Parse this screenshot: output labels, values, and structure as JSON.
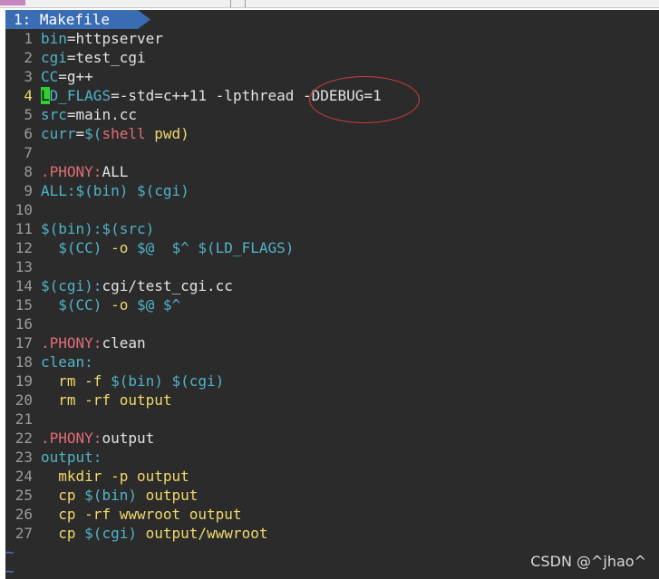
{
  "tab": {
    "label": "1: Makefile"
  },
  "lines": [
    {
      "n": "1",
      "tokens": [
        {
          "t": "bin",
          "c": "var"
        },
        {
          "t": "=httpserver",
          "c": "default"
        }
      ]
    },
    {
      "n": "2",
      "tokens": [
        {
          "t": "cgi",
          "c": "var"
        },
        {
          "t": "=test_cgi",
          "c": "default"
        }
      ]
    },
    {
      "n": "3",
      "tokens": [
        {
          "t": "CC",
          "c": "var"
        },
        {
          "t": "=g++",
          "c": "default"
        }
      ]
    },
    {
      "n": "4",
      "current": true,
      "tokens": [
        {
          "t": "L",
          "c": "cursor"
        },
        {
          "t": "D_FLAGS",
          "c": "var"
        },
        {
          "t": "=-std=c++11 -lpthread -DDEBUG=1",
          "c": "default"
        }
      ]
    },
    {
      "n": "5",
      "tokens": [
        {
          "t": "src",
          "c": "var"
        },
        {
          "t": "=main.cc",
          "c": "default"
        }
      ]
    },
    {
      "n": "6",
      "tokens": [
        {
          "t": "curr",
          "c": "var"
        },
        {
          "t": "=",
          "c": "default"
        },
        {
          "t": "$(",
          "c": "var"
        },
        {
          "t": "shell",
          "c": "keyword"
        },
        {
          "t": " pwd)",
          "c": "command"
        }
      ]
    },
    {
      "n": "7",
      "tokens": []
    },
    {
      "n": "8",
      "tokens": [
        {
          "t": ".PHONY:",
          "c": "keyword"
        },
        {
          "t": "ALL",
          "c": "default"
        }
      ]
    },
    {
      "n": "9",
      "tokens": [
        {
          "t": "ALL:",
          "c": "var"
        },
        {
          "t": "$(bin) $(cgi)",
          "c": "var"
        }
      ]
    },
    {
      "n": "10",
      "tokens": []
    },
    {
      "n": "11",
      "tokens": [
        {
          "t": "$(bin):$(src)",
          "c": "var"
        }
      ]
    },
    {
      "n": "12",
      "tokens": [
        {
          "t": "  ",
          "c": "default"
        },
        {
          "t": "$(CC)",
          "c": "var"
        },
        {
          "t": " -o ",
          "c": "command"
        },
        {
          "t": "$@",
          "c": "var"
        },
        {
          "t": "  ",
          "c": "default"
        },
        {
          "t": "$^ $(LD_FLAGS)",
          "c": "var"
        }
      ]
    },
    {
      "n": "13",
      "tokens": []
    },
    {
      "n": "14",
      "tokens": [
        {
          "t": "$(cgi):",
          "c": "var"
        },
        {
          "t": "cgi/test_cgi.cc",
          "c": "default"
        }
      ]
    },
    {
      "n": "15",
      "tokens": [
        {
          "t": "  ",
          "c": "default"
        },
        {
          "t": "$(CC)",
          "c": "var"
        },
        {
          "t": " -o ",
          "c": "command"
        },
        {
          "t": "$@ $^",
          "c": "var"
        }
      ]
    },
    {
      "n": "16",
      "tokens": []
    },
    {
      "n": "17",
      "tokens": [
        {
          "t": ".PHONY:",
          "c": "keyword"
        },
        {
          "t": "clean",
          "c": "default"
        }
      ]
    },
    {
      "n": "18",
      "tokens": [
        {
          "t": "clean:",
          "c": "var"
        }
      ]
    },
    {
      "n": "19",
      "tokens": [
        {
          "t": "  rm -f ",
          "c": "command"
        },
        {
          "t": "$(bin) $(cgi)",
          "c": "var"
        }
      ]
    },
    {
      "n": "20",
      "tokens": [
        {
          "t": "  rm -rf output",
          "c": "command"
        }
      ]
    },
    {
      "n": "21",
      "tokens": []
    },
    {
      "n": "22",
      "tokens": [
        {
          "t": ".PHONY:",
          "c": "keyword"
        },
        {
          "t": "output",
          "c": "default"
        }
      ]
    },
    {
      "n": "23",
      "tokens": [
        {
          "t": "output:",
          "c": "var"
        }
      ]
    },
    {
      "n": "24",
      "tokens": [
        {
          "t": "  mkdir -p output",
          "c": "command"
        }
      ]
    },
    {
      "n": "25",
      "tokens": [
        {
          "t": "  cp ",
          "c": "command"
        },
        {
          "t": "$(bin)",
          "c": "var"
        },
        {
          "t": " output",
          "c": "command"
        }
      ]
    },
    {
      "n": "26",
      "tokens": [
        {
          "t": "  cp -rf wwwroot output",
          "c": "command"
        }
      ]
    },
    {
      "n": "27",
      "tokens": [
        {
          "t": "  cp ",
          "c": "command"
        },
        {
          "t": "$(cgi)",
          "c": "var"
        },
        {
          "t": " output/wwwroot",
          "c": "command"
        }
      ]
    }
  ],
  "tildes": [
    "~",
    "~"
  ],
  "watermark": "CSDN @^jhao^",
  "colors": {
    "background": "#2b2b2b",
    "tab": "#3a6cb4",
    "variable": "#4fb3c8",
    "keyword": "#e06c75",
    "command": "#f0d86a",
    "cursor": "#30d030",
    "annotation": "#d23c3c"
  }
}
